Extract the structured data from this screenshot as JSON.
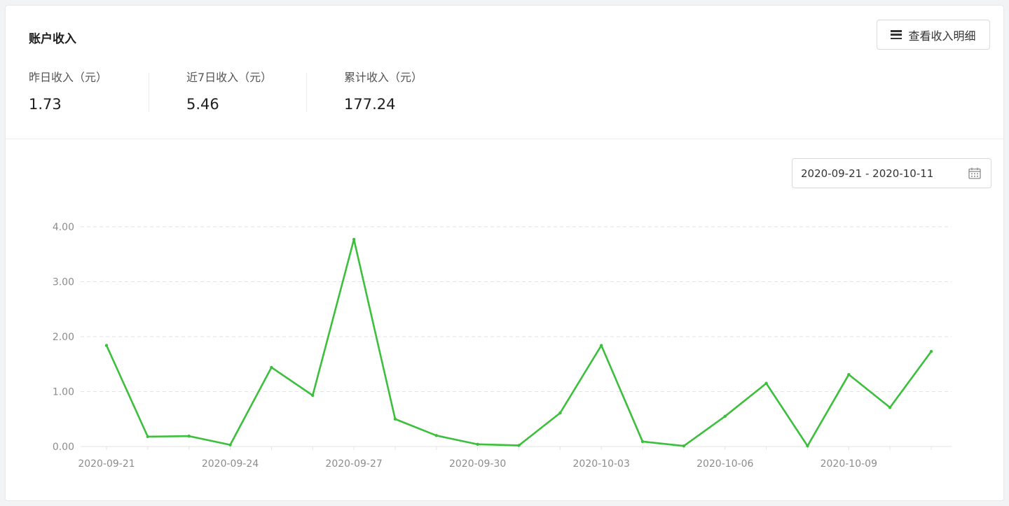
{
  "panel": {
    "title": "账户收入",
    "detail_button_label": "查看收入明细",
    "detail_button_icon": "menu-icon"
  },
  "stats": [
    {
      "label": "昨日收入（元）",
      "value": "1.73"
    },
    {
      "label": "近7日收入（元）",
      "value": "5.46"
    },
    {
      "label": "累计收入（元）",
      "value": "177.24"
    }
  ],
  "date_range": {
    "start": "2020-09-21",
    "end": "2020-10-11",
    "separator": "-",
    "icon": "calendar-icon"
  },
  "colors": {
    "line": "#3cbf3c",
    "grid": "#e3e3e3",
    "axis_text": "#8c8c8c"
  },
  "chart_data": {
    "type": "line",
    "x": [
      "2020-09-21",
      "2020-09-22",
      "2020-09-23",
      "2020-09-24",
      "2020-09-25",
      "2020-09-26",
      "2020-09-27",
      "2020-09-28",
      "2020-09-29",
      "2020-09-30",
      "2020-10-01",
      "2020-10-02",
      "2020-10-03",
      "2020-10-04",
      "2020-10-05",
      "2020-10-06",
      "2020-10-07",
      "2020-10-08",
      "2020-10-09",
      "2020-10-10",
      "2020-10-11"
    ],
    "x_tick_labels": [
      "2020-09-21",
      "2020-09-24",
      "2020-09-27",
      "2020-09-30",
      "2020-10-03",
      "2020-10-06",
      "2020-10-09"
    ],
    "series": [
      {
        "values": [
          1.84,
          0.18,
          0.19,
          0.03,
          1.44,
          0.93,
          3.77,
          0.5,
          0.2,
          0.04,
          0.02,
          0.61,
          1.84,
          0.09,
          0.01,
          0.55,
          1.15,
          0.01,
          1.31,
          0.71,
          1.73
        ]
      }
    ],
    "ylim": [
      0,
      4
    ],
    "y_ticks": [
      "0.00",
      "1.00",
      "2.00",
      "3.00",
      "4.00"
    ],
    "grid": true,
    "grid_style": "dashed",
    "xlabel": "",
    "ylabel": ""
  }
}
